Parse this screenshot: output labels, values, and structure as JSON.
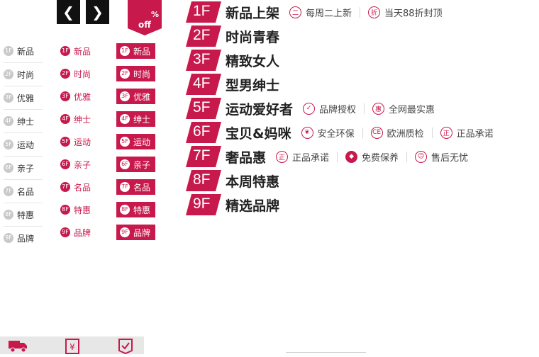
{
  "arrows": {
    "prev": "❮",
    "next": "❯"
  },
  "off_badge": {
    "percent": "%",
    "label": "off"
  },
  "nav_columns": [
    [
      {
        "num": "1F",
        "label": "新品"
      },
      {
        "num": "2F",
        "label": "时尚"
      },
      {
        "num": "3F",
        "label": "优雅"
      },
      {
        "num": "4F",
        "label": "绅士"
      },
      {
        "num": "5F",
        "label": "运动"
      },
      {
        "num": "6F",
        "label": "亲子"
      },
      {
        "num": "7F",
        "label": "名品"
      },
      {
        "num": "8F",
        "label": "特惠"
      },
      {
        "num": "9F",
        "label": "品牌"
      }
    ],
    [
      {
        "num": "1F",
        "label": "新品"
      },
      {
        "num": "2F",
        "label": "时尚"
      },
      {
        "num": "3F",
        "label": "优雅"
      },
      {
        "num": "4F",
        "label": "绅士"
      },
      {
        "num": "5F",
        "label": "运动"
      },
      {
        "num": "6F",
        "label": "亲子"
      },
      {
        "num": "7F",
        "label": "名品"
      },
      {
        "num": "8F",
        "label": "特惠"
      },
      {
        "num": "9F",
        "label": "品牌"
      }
    ],
    [
      {
        "num": "1F",
        "label": "新品"
      },
      {
        "num": "2F",
        "label": "时尚"
      },
      {
        "num": "3F",
        "label": "优雅"
      },
      {
        "num": "4F",
        "label": "绅士"
      },
      {
        "num": "5F",
        "label": "运动"
      },
      {
        "num": "6F",
        "label": "亲子"
      },
      {
        "num": "7F",
        "label": "名品"
      },
      {
        "num": "8F",
        "label": "特惠"
      },
      {
        "num": "9F",
        "label": "品牌"
      }
    ]
  ],
  "floors": [
    {
      "num": "1F",
      "title": "新品上架",
      "features": [
        {
          "icon": "二",
          "label": "每周二上新"
        },
        {
          "icon": "折",
          "label": "当天88折封顶"
        }
      ]
    },
    {
      "num": "2F",
      "title": "时尚青春",
      "features": []
    },
    {
      "num": "3F",
      "title": "精致女人",
      "features": []
    },
    {
      "num": "4F",
      "title": "型男绅士",
      "features": []
    },
    {
      "num": "5F",
      "title": "运动爱好者",
      "features": [
        {
          "icon": "✓",
          "label": "品牌授权"
        },
        {
          "icon": "惠",
          "label": "全网最实惠"
        }
      ]
    },
    {
      "num": "6F",
      "title": "宝贝&妈咪",
      "features": [
        {
          "icon": "❦",
          "label": "安全环保"
        },
        {
          "icon": "CE",
          "label": "欧洲质检"
        },
        {
          "icon": "正",
          "label": "正品承诺"
        }
      ]
    },
    {
      "num": "7F",
      "title": "奢品惠",
      "features": [
        {
          "icon": "正",
          "label": "正品承诺"
        },
        {
          "icon": "◆",
          "label": "免费保养",
          "solid": true
        },
        {
          "icon": "☺",
          "label": "售后无忧"
        }
      ]
    },
    {
      "num": "8F",
      "title": "本周特惠",
      "features": []
    },
    {
      "num": "9F",
      "title": "精选品牌",
      "features": []
    }
  ],
  "bottom_icons": [
    "truck-icon",
    "yen-receipt-icon",
    "check-list-icon"
  ],
  "colors": {
    "accent": "#c8194d",
    "dark": "#111111",
    "gray": "#c9c9c9"
  }
}
